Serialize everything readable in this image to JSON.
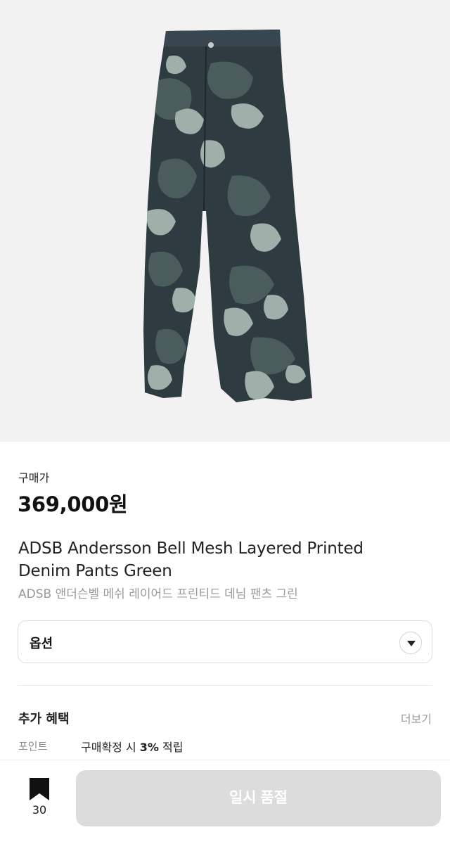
{
  "product": {
    "image_alt": "camo printed denim pants",
    "price_label": "구매가",
    "price": "369,000원",
    "title_en_line1": "ADSB Andersson Bell Mesh Layered Printed",
    "title_en_line2": "Denim Pants Green",
    "title_ko": "ADSB 앤더슨벨 메쉬 레이어드 프린티드 데님 팬츠 그린"
  },
  "option": {
    "label": "옵션",
    "icon": "chevron-down-icon"
  },
  "benefits": {
    "title": "추가 혜택",
    "more_label": "더보기",
    "point_label": "포인트",
    "point_prefix": "구매확정 시 ",
    "point_rate": "3%",
    "point_suffix": " 적립"
  },
  "bottom": {
    "bookmark_icon": "bookmark-icon",
    "bookmark_count": "30",
    "soldout_label": "일시 품절"
  },
  "colors": {
    "hero_bg": "#f2f2f3",
    "denim_dark": "#2e3b40",
    "camo_mid": "#4a5c5c",
    "camo_light": "#9fb0ab",
    "disabled_button": "#dcdcdc",
    "muted_text": "#9a9a9a"
  }
}
